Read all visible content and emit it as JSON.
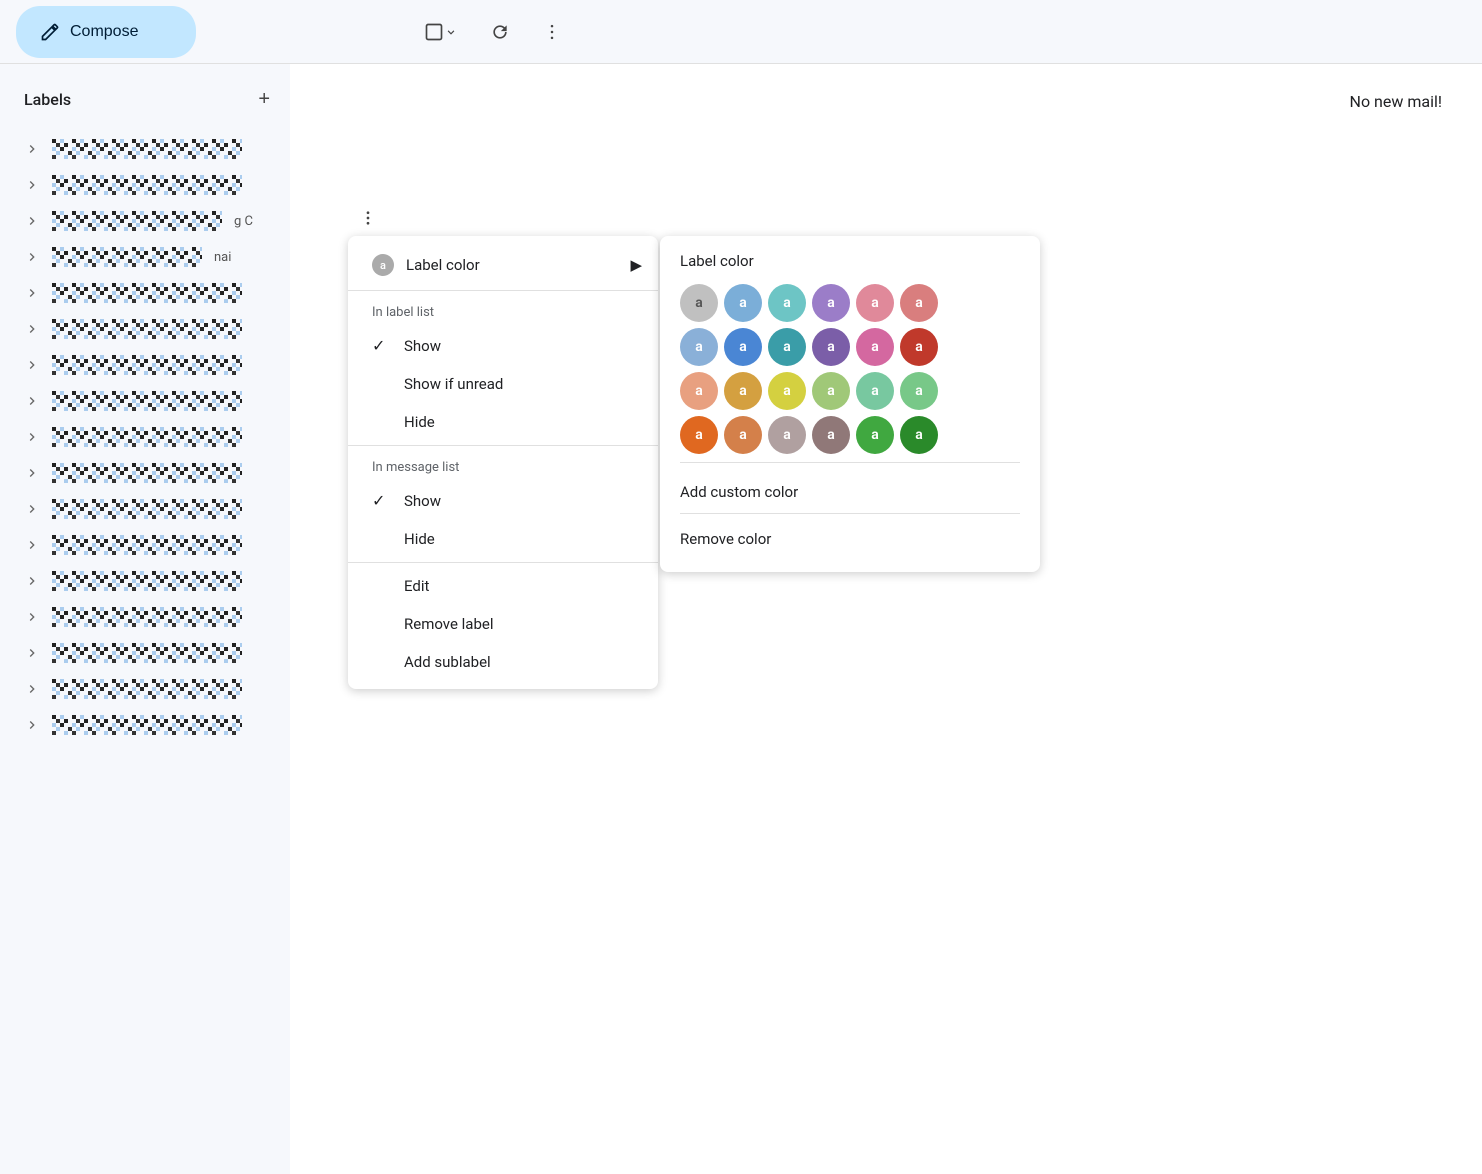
{
  "toolbar": {
    "compose_label": "Compose",
    "no_mail_text": "No new mail!"
  },
  "sidebar": {
    "labels_title": "Labels",
    "add_btn": "+",
    "items": [
      {
        "id": 1
      },
      {
        "id": 2
      },
      {
        "id": 3
      },
      {
        "id": 4
      },
      {
        "id": 5
      },
      {
        "id": 6
      },
      {
        "id": 7
      },
      {
        "id": 8
      },
      {
        "id": 9
      },
      {
        "id": 10
      },
      {
        "id": 11
      },
      {
        "id": 12
      },
      {
        "id": 13
      },
      {
        "id": 14
      },
      {
        "id": 15
      },
      {
        "id": 16
      }
    ]
  },
  "context_menu": {
    "label_color_item": "Label color",
    "in_label_list_header": "In label list",
    "show_checked": "Show",
    "show_if_unread": "Show if unread",
    "hide_label_list": "Hide",
    "in_message_list_header": "In message list",
    "show_msg_checked": "Show",
    "hide_msg": "Hide",
    "edit": "Edit",
    "remove_label": "Remove label",
    "add_sublabel": "Add sublabel"
  },
  "label_color_submenu": {
    "title": "Label color",
    "add_custom": "Add custom color",
    "remove_color": "Remove color",
    "colors": [
      {
        "bg": "#c0c0c0",
        "text_color": "#fff"
      },
      {
        "bg": "#7bb3d8",
        "text_color": "#fff"
      },
      {
        "bg": "#6dc5c5",
        "text_color": "#fff"
      },
      {
        "bg": "#9b7dc8",
        "text_color": "#fff"
      },
      {
        "bg": "#e0899a",
        "text_color": "#fff"
      },
      {
        "bg": "#d97e7e",
        "text_color": "#fff"
      },
      {
        "bg": "#6a9fd8",
        "text_color": "#fff"
      },
      {
        "bg": "#4a86d4",
        "text_color": "#fff"
      },
      {
        "bg": "#3a9da8",
        "text_color": "#fff"
      },
      {
        "bg": "#7b5ea8",
        "text_color": "#fff"
      },
      {
        "bg": "#d468a0",
        "text_color": "#fff"
      },
      {
        "bg": "#c0392b",
        "text_color": "#fff"
      },
      {
        "bg": "#e8a080",
        "text_color": "#fff"
      },
      {
        "bg": "#d4a040",
        "text_color": "#fff"
      },
      {
        "bg": "#d4c040",
        "text_color": "#fff"
      },
      {
        "bg": "#a0c878",
        "text_color": "#fff"
      },
      {
        "bg": "#78c8a0",
        "text_color": "#fff"
      },
      {
        "bg": "#78c888",
        "text_color": "#fff"
      },
      {
        "bg": "#e06820",
        "text_color": "#fff"
      },
      {
        "bg": "#e08030",
        "text_color": "#fff"
      },
      {
        "bg": "#b8b8b8",
        "text_color": "#fff"
      },
      {
        "bg": "#a08080",
        "text_color": "#fff"
      },
      {
        "bg": "#40a840",
        "text_color": "#fff"
      },
      {
        "bg": "#2a8a2a",
        "text_color": "#fff"
      }
    ]
  }
}
